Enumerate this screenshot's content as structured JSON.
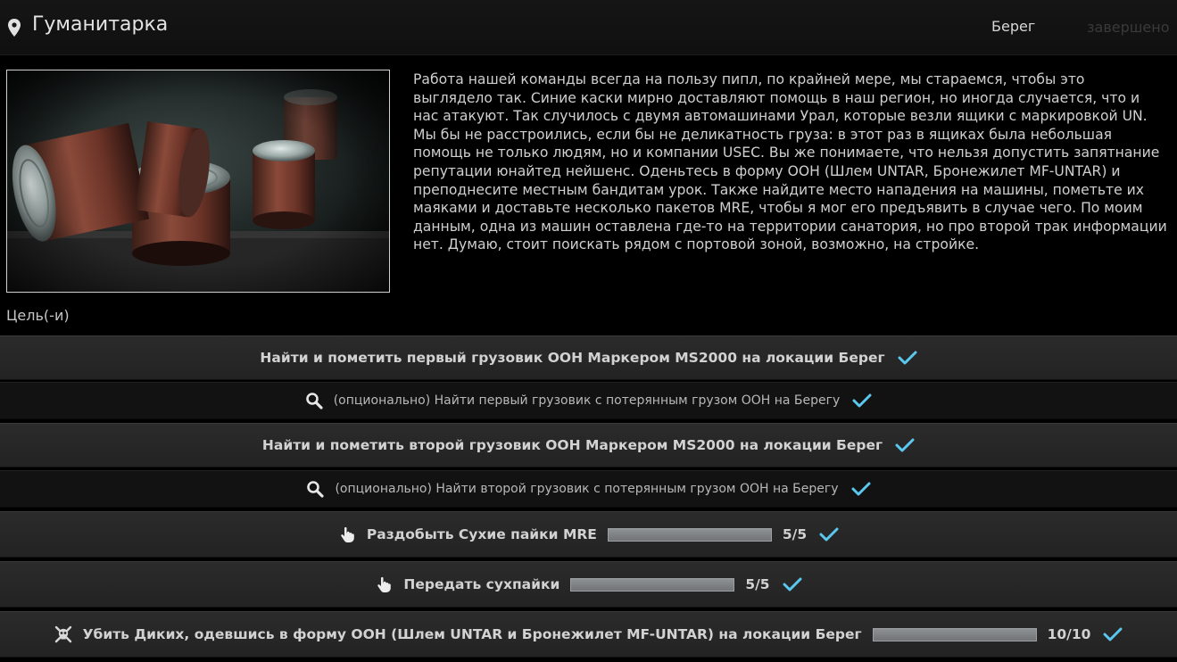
{
  "header": {
    "icon": "map-pin-icon",
    "title": "Гуманитарка",
    "location": "Берег",
    "status": "завершено"
  },
  "description": "Работа нашей команды всегда на пользу пипл, по крайней мере, мы стараемся, чтобы это выглядело так. Синие каски мирно доставляют помощь в наш регион, но иногда случается, что и нас атакуют. Так случилось с двумя автомашинами Урал, которые везли ящики с маркировкой UN. Мы бы не расстроились, если бы не деликатность груза: в этот раз в ящиках была небольшая помощь не только людям, но и компании USEC. Вы же понимаете, что нельзя допустить запятнание репутации юнайтед нейшенс. Оденьтесь в форму ООН (Шлем UNTAR, Бронежилет MF-UNTAR) и преподнесите местным бандитам урок. Также найдите место нападения на машины, пометьте их маяками и доставьте несколько пакетов MRE, чтобы я мог его предъявить в случае чего. По моим данным, одна из машин оставлена где-то на территории санатория, но про второй трак информации нет. Думаю, стоит поискать рядом с портовой зоной, возможно, на стройке.",
  "objectives_label": "Цель(-и)",
  "objectives": [
    {
      "text": "Найти и пометить первый грузовик ООН Маркером MS2000 на локации Берег",
      "type": "primary",
      "icon": "",
      "completed": true
    },
    {
      "text": "(опционально) Найти первый грузовик с потерянным грузом ООН на Берегу",
      "type": "optional",
      "icon": "search-icon",
      "completed": true
    },
    {
      "text": "Найти и пометить второй грузовик ООН Маркером MS2000 на локации Берег",
      "type": "primary",
      "icon": "",
      "completed": true
    },
    {
      "text": "(опционально) Найти второй грузовик с потерянным грузом ООН на Берегу",
      "type": "optional",
      "icon": "search-icon",
      "completed": true
    },
    {
      "text": "Раздобыть Сухие пайки MRE",
      "type": "primary",
      "icon": "hand-pointer-icon",
      "progress": "5/5",
      "progress_fraction": 1.0,
      "completed": true
    },
    {
      "text": "Передать сухпайки",
      "type": "primary",
      "icon": "hand-pointer-icon",
      "progress": "5/5",
      "progress_fraction": 1.0,
      "completed": true
    },
    {
      "text": "Убить Диких, одевшись в форму ООН (Шлем UNTAR и Бронежилет MF-UNTAR) на локации Берег",
      "type": "primary",
      "icon": "skull-crossbones-icon",
      "progress": "10/10",
      "progress_fraction": 1.0,
      "completed": true
    }
  ],
  "colors": {
    "check": "#5bc8f0",
    "status_dim": "#3a3a3a"
  }
}
